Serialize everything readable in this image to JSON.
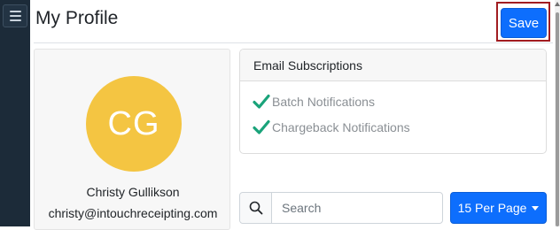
{
  "sidebar": {
    "menu_icon": "hamburger-menu-icon"
  },
  "header": {
    "title": "My Profile",
    "save_label": "Save"
  },
  "profile": {
    "initials": "CG",
    "avatar_color": "#f4c542",
    "name": "Christy Gullikson",
    "email": "christy@intouchreceipting.com"
  },
  "email_subscriptions": {
    "title": "Email Subscriptions",
    "items": [
      {
        "label": "Batch Notifications",
        "checked": true
      },
      {
        "label": "Chargeback Notifications",
        "checked": true
      }
    ],
    "check_color": "#1aa37a"
  },
  "search": {
    "icon": "search-icon",
    "placeholder": "Search",
    "value": ""
  },
  "per_page": {
    "label": "15 Per Page",
    "icon": "caret-down-icon"
  },
  "colors": {
    "primary": "#0d6efd",
    "sidebar": "#1c2b39",
    "highlight": "#a11d21"
  }
}
